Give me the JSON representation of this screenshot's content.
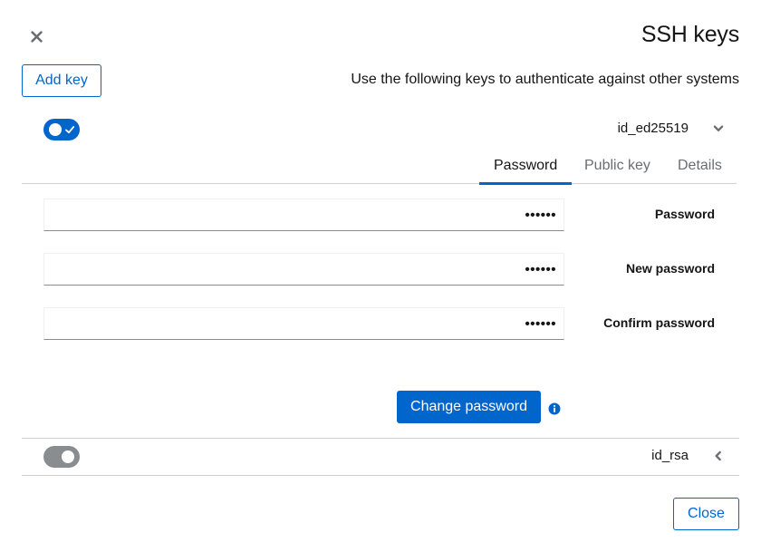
{
  "dialog": {
    "title": "SSH keys",
    "description": "Use the following keys to authenticate against other systems",
    "add_key_label": "Add key",
    "close_label": "Close"
  },
  "keys": [
    {
      "name": "id_ed25519",
      "enabled": true,
      "expanded": true,
      "tabs": [
        "Password",
        "Public key",
        "Details"
      ],
      "active_tab": "Password",
      "fields": [
        {
          "label": "Password",
          "value": "••••••"
        },
        {
          "label": "New password",
          "value": "••••••"
        },
        {
          "label": "Confirm password",
          "value": "••••••"
        }
      ],
      "change_password_label": "Change password"
    },
    {
      "name": "id_rsa",
      "enabled": false,
      "expanded": false
    }
  ],
  "colors": {
    "primary": "#0066cc",
    "toggle_off": "#8a8d90",
    "border": "#d2d2d2"
  },
  "icons": [
    "close-icon",
    "check-icon",
    "chevron-down-icon",
    "chevron-left-icon",
    "info-circle-icon"
  ]
}
